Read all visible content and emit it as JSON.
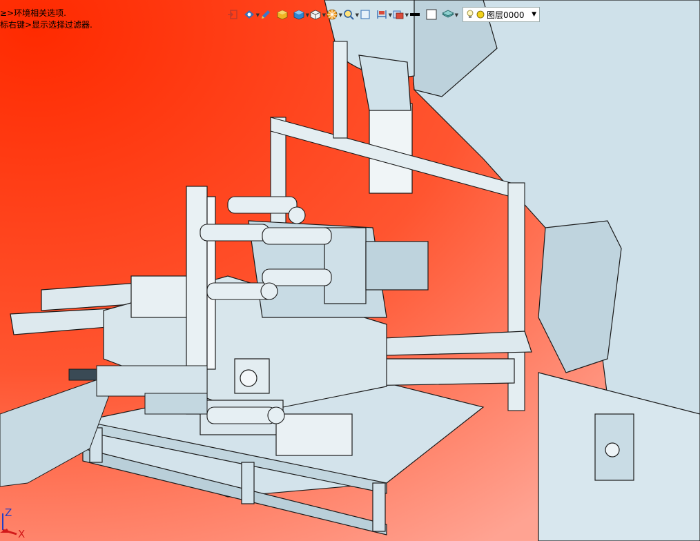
{
  "status": {
    "line1": "≥>环境相关选项.",
    "line2": "标右键>显示选择过滤器."
  },
  "toolbar": {
    "icons": [
      "exit-sketch-icon",
      "view-style-icon",
      "pencil-icon",
      "box-yellow-icon",
      "cube-blue-icon",
      "wire-cube-icon",
      "section-wheel-icon",
      "zoom-icon",
      "frame-icon",
      "dimension-icon",
      "snapshot-icon"
    ],
    "line_color": "#000000",
    "fill_color": "#ffffff",
    "layer_label": "图层0000",
    "bulb_color": "#f2d21b"
  },
  "scene": {
    "background_top": "#ff2a00",
    "background_bottom": "#ffa392",
    "metal_color": "#cfe1ea",
    "edge_color": "#1a1a1a"
  },
  "axis": {
    "z_label": "Z",
    "x_label": "X",
    "z_color": "#1f3ec6",
    "x_color": "#d21a1a"
  }
}
